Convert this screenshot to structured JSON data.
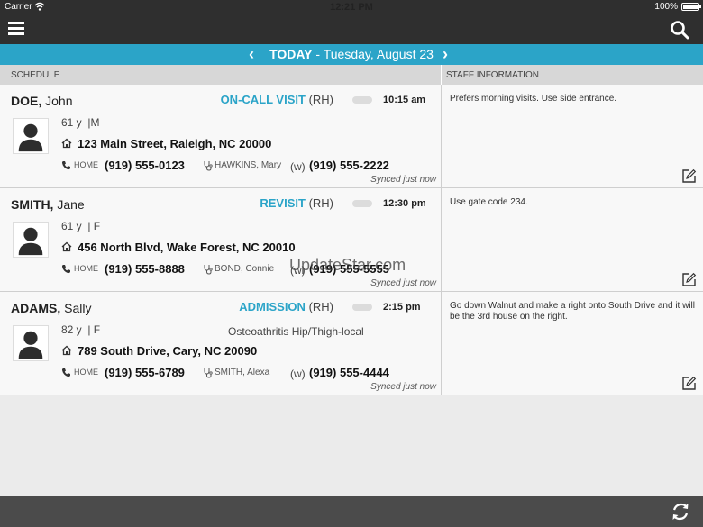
{
  "statusbar": {
    "carrier": "Carrier",
    "time": "12:21 PM",
    "battery": "100%"
  },
  "navbar": {
    "menu_icon": "hamburger-menu-icon",
    "search_icon": "magnifier-icon"
  },
  "datebar": {
    "today": "TODAY",
    "separator": " - ",
    "date": "Tuesday, August 23",
    "prev_icon": "chevron-left-icon",
    "next_icon": "chevron-right-icon",
    "color": "#2ba4c8"
  },
  "columns": {
    "schedule": "SCHEDULE",
    "staff": "STAFF INFORMATION"
  },
  "visits": [
    {
      "last": "DOE,",
      "first": "John",
      "visit_type": "ON-CALL VISIT",
      "visit_suffix": "(RH)",
      "time": "10:15 am",
      "age": "61 y",
      "sex": "|M",
      "diagnosis": "",
      "address": "123 Main Street, Raleigh, NC 20000",
      "home_label": "HOME",
      "home_phone": "(919) 555-0123",
      "caregiver": "HAWKINS, Mary",
      "w_label": "(w)",
      "work_phone": "(919) 555-2222",
      "synced": "Synced just now",
      "staff_info": "Prefers morning visits. Use side entrance."
    },
    {
      "last": "SMITH,",
      "first": "Jane",
      "visit_type": "REVISIT",
      "visit_suffix": "(RH)",
      "time": "12:30 pm",
      "age": "61 y",
      "sex": "| F",
      "diagnosis": "",
      "address": "456 North Blvd, Wake Forest, NC 20010",
      "home_label": "HOME",
      "home_phone": "(919) 555-8888",
      "caregiver": "BOND, Connie",
      "w_label": "(w)",
      "work_phone": "(919) 555-5555",
      "synced": "Synced just now",
      "staff_info": "Use gate code 234."
    },
    {
      "last": "ADAMS,",
      "first": "Sally",
      "visit_type": "ADMISSION",
      "visit_suffix": "(RH)",
      "time": "2:15 pm",
      "age": "82 y",
      "sex": "| F",
      "diagnosis": "Osteoathritis Hip/Thigh-local",
      "address": "789 South Drive, Cary, NC 20090",
      "home_label": "HOME",
      "home_phone": "(919) 555-6789",
      "caregiver": "SMITH, Alexa",
      "w_label": "(w)",
      "work_phone": "(919) 555-4444",
      "synced": "Synced just now",
      "staff_info": "Go down Walnut and make a right onto South Drive and it will be the 3rd house on the right."
    }
  ],
  "watermark": "UpdateStar.com",
  "bottombar": {
    "refresh_icon": "refresh-sync-icon"
  }
}
